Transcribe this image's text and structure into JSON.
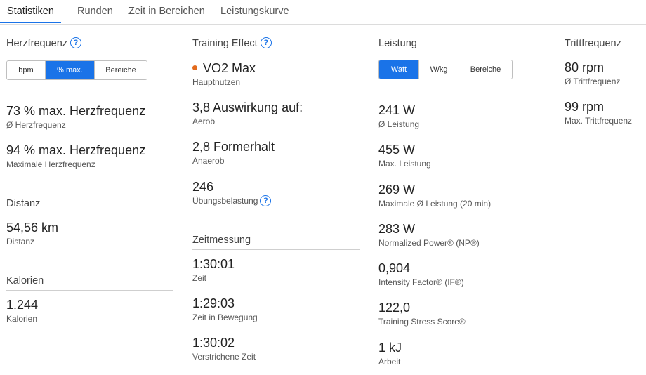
{
  "tabs": [
    "Statistiken",
    "Runden",
    "Zeit in Bereichen",
    "Leistungskurve"
  ],
  "colors": {
    "accent": "#1a73e8",
    "orange_dot": "#e36b1d"
  },
  "herz": {
    "title": "Herzfrequenz",
    "seg": [
      "bpm",
      "% max.",
      "Bereiche"
    ],
    "seg_selected": "% max.",
    "avg_value": "73 % max. Herzfrequenz",
    "avg_label": "Ø Herzfrequenz",
    "max_value": "94 % max. Herzfrequenz",
    "max_label": "Maximale Herzfrequenz"
  },
  "distanz": {
    "title": "Distanz",
    "value": "54,56 km",
    "label": "Distanz"
  },
  "kalorien": {
    "title": "Kalorien",
    "value": "1.244",
    "label": "Kalorien"
  },
  "training": {
    "title": "Training Effect",
    "primary_value": "VO2 Max",
    "primary_label": "Hauptnutzen",
    "aerob_value": "3,8 Auswirkung auf:",
    "aerob_label": "Aerob",
    "anaerob_value": "2,8 Formerhalt",
    "anaerob_label": "Anaerob",
    "load_value": "246",
    "load_label": "Übungsbelastung"
  },
  "zeit": {
    "title": "Zeitmessung",
    "t1_value": "1:30:01",
    "t1_label": "Zeit",
    "t2_value": "1:29:03",
    "t2_label": "Zeit in Bewegung",
    "t3_value": "1:30:02",
    "t3_label": "Verstrichene Zeit"
  },
  "leistung": {
    "title": "Leistung",
    "seg": [
      "Watt",
      "W/kg",
      "Bereiche"
    ],
    "seg_selected": "Watt",
    "items": [
      {
        "value": "241 W",
        "label": "Ø Leistung"
      },
      {
        "value": "455 W",
        "label": "Max. Leistung"
      },
      {
        "value": "269 W",
        "label": "Maximale Ø Leistung (20 min)"
      },
      {
        "value": "283 W",
        "label": "Normalized Power® (NP®)"
      },
      {
        "value": "0,904",
        "label": "Intensity Factor® (IF®)"
      },
      {
        "value": "122,0",
        "label": "Training Stress Score®"
      },
      {
        "value": "1 kJ",
        "label": "Arbeit"
      }
    ]
  },
  "tritt": {
    "title": "Trittfrequenz",
    "avg_value": "80 rpm",
    "avg_label": "Ø Trittfrequenz",
    "max_value": "99 rpm",
    "max_label": "Max. Trittfrequenz"
  }
}
